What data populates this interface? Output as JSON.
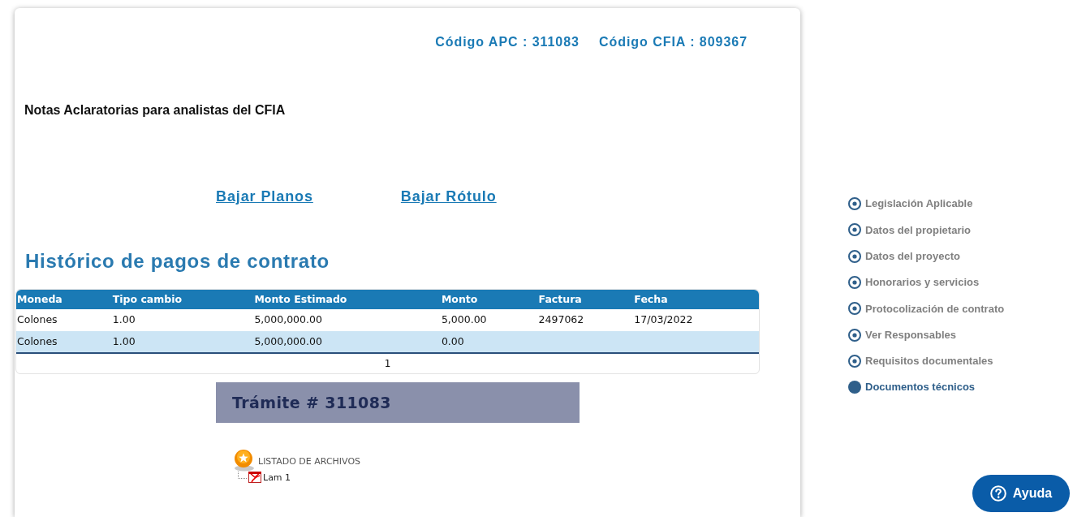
{
  "header": {
    "codes": [
      "Código APC : 311083",
      "Código CFIA : 809367"
    ]
  },
  "notes_title": "Notas Aclaratorias para analistas del CFIA",
  "links": [
    "Bajar Planos",
    "Bajar Rótulo"
  ],
  "payments": {
    "title": "Histórico de pagos de contrato",
    "columns": [
      "Moneda",
      "Tipo cambio",
      "Monto Estimado",
      "Monto",
      "Factura",
      "Fecha"
    ],
    "rows": [
      [
        "Colones",
        "1.00",
        "5,000,000.00",
        "5,000.00",
        "2497062",
        "17/03/2022"
      ],
      [
        "Colones",
        "1.00",
        "5,000,000.00",
        "0.00"
      ]
    ],
    "pager": [
      {
        "label": "1",
        "selected": true
      }
    ]
  },
  "tramite": {
    "title": "Trámite # 311083"
  },
  "files": {
    "title": "LISTADO DE ARCHIVOS",
    "children": [
      {
        "label": "Lam 1"
      }
    ]
  },
  "nav": {
    "items": [
      {
        "label": "Legislación Aplicable",
        "selected": false
      },
      {
        "label": "Datos del propietario",
        "selected": false
      },
      {
        "label": "Datos del proyecto",
        "selected": false
      },
      {
        "label": "Honorarios y servicios",
        "selected": false
      },
      {
        "label": "Protocolización de contrato",
        "selected": false
      },
      {
        "label": "Ver Responsables",
        "selected": false
      },
      {
        "label": "Requisitos documentales",
        "selected": false
      },
      {
        "label": "Documentos técnicos",
        "selected": true
      }
    ]
  },
  "help_button": {
    "label": "Ayuda"
  }
}
